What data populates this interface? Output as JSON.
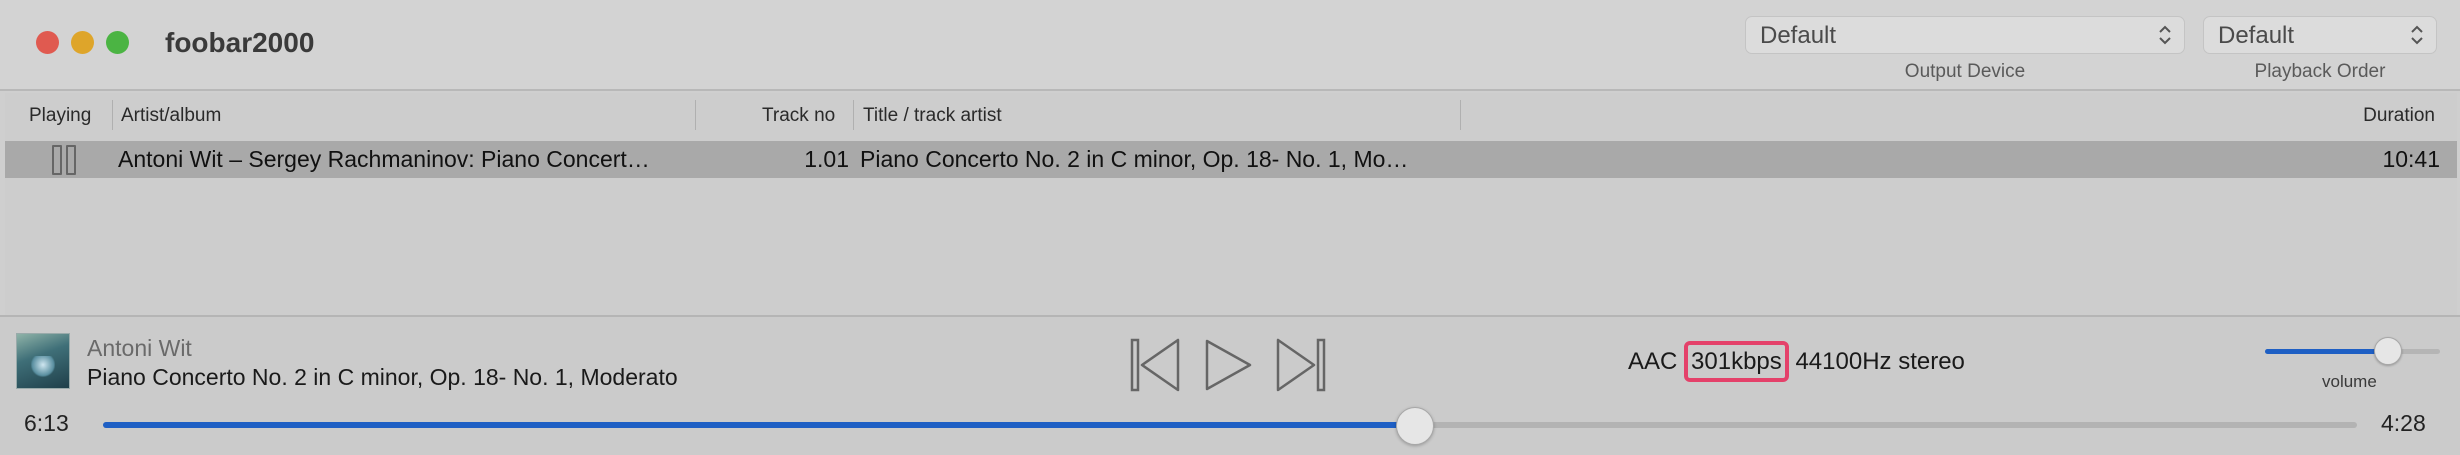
{
  "window": {
    "title": "foobar2000"
  },
  "toolbar": {
    "output_device": {
      "value": "Default",
      "label": "Output Device"
    },
    "playback_order": {
      "value": "Default",
      "label": "Playback Order"
    }
  },
  "playlist": {
    "columns": {
      "playing": "Playing",
      "artist_album": "Artist/album",
      "track_no": "Track no",
      "title": "Title / track artist",
      "duration": "Duration"
    },
    "rows": [
      {
        "state_icon": "pause-icon",
        "artist_album": "Antoni Wit – Sergey Rachmaninov: Piano Concert…",
        "track_no": "1.01",
        "title": "Piano Concerto No. 2 in C minor, Op. 18- No. 1, Mo…",
        "duration": "10:41"
      }
    ]
  },
  "now_playing": {
    "artist": "Antoni Wit",
    "title": "Piano Concerto No. 2 in C minor, Op. 18- No. 1, Moderato",
    "format": {
      "codec": "AAC",
      "bitrate": "301kbps",
      "rest": "44100Hz stereo"
    },
    "elapsed": "6:13",
    "remaining": "4:28",
    "progress": 0.582,
    "volume": 0.7,
    "volume_label": "volume"
  },
  "colors": {
    "accent": "#1e5fc4",
    "highlight_box": "#e4416a",
    "close": "#e05a50",
    "minimize": "#dea52a",
    "maximize": "#4bb443"
  },
  "icons": [
    "previous-track-icon",
    "play-icon",
    "next-track-icon",
    "pause-icon",
    "chevron-updown-icon"
  ]
}
